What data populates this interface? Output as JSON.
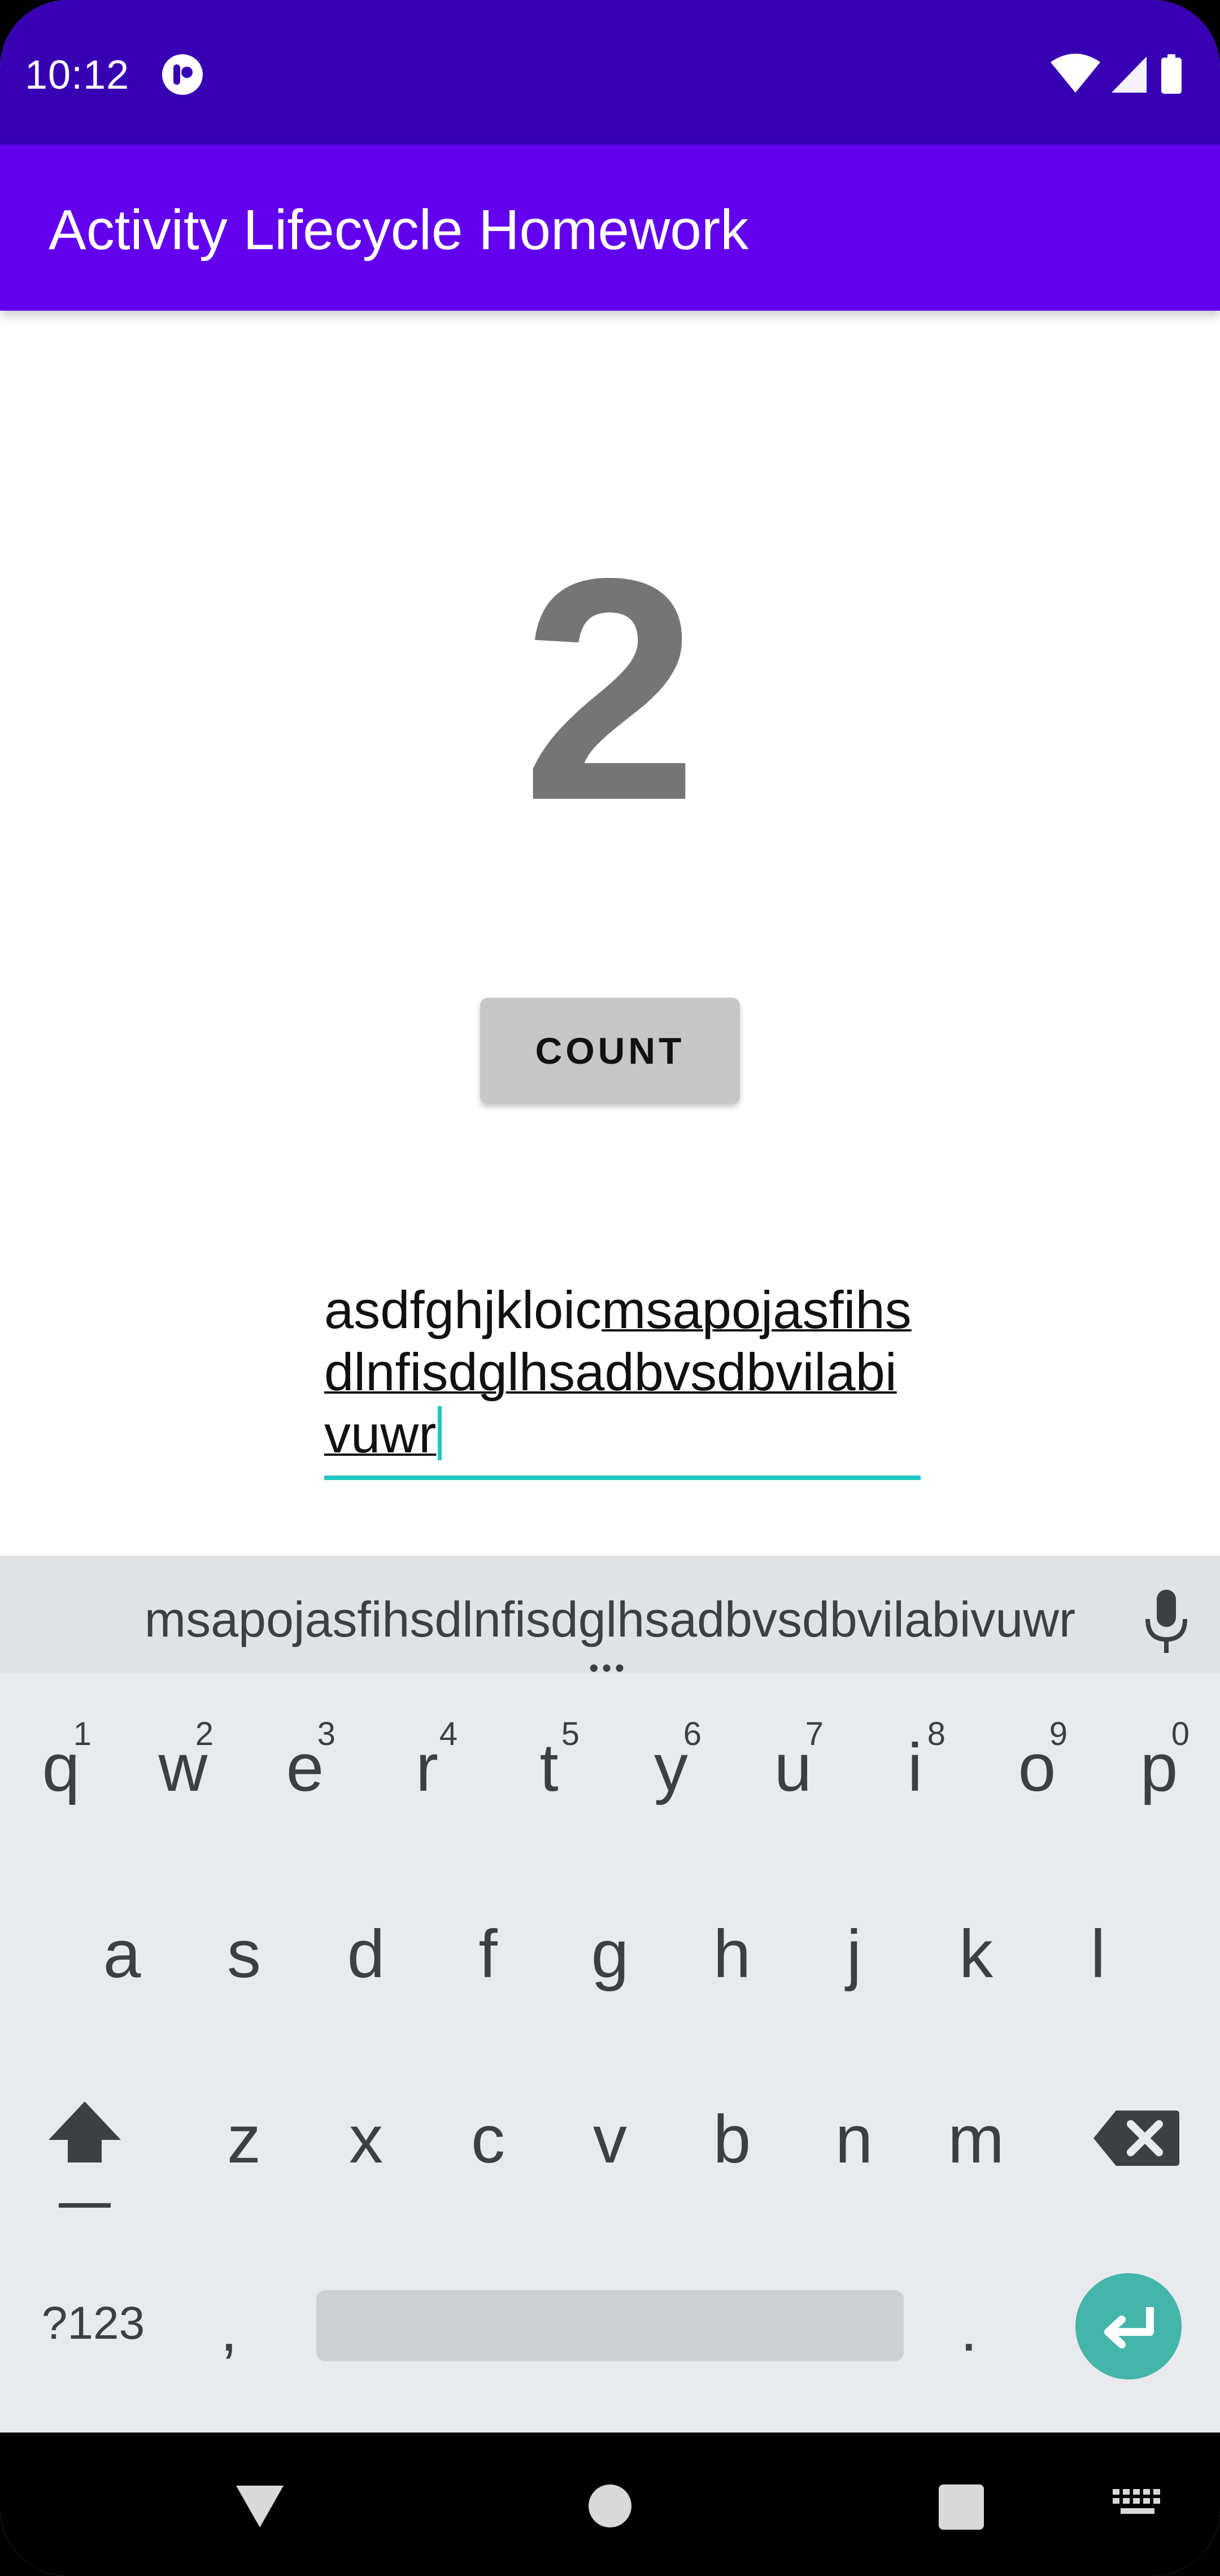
{
  "status_bar": {
    "time": "10:12"
  },
  "app_bar": {
    "title": "Activity Lifecycle Homework"
  },
  "main": {
    "counter": "2",
    "count_button": "COUNT",
    "edit_text": {
      "plain": "asdfghjkloic",
      "composing": "msapojasfihsdlnfisdglhsadbvsdbvilabivuwr"
    }
  },
  "keyboard": {
    "suggestion": "msapojasfihsdlnfisdglhsadbvsdbvilabivuwr",
    "row1": [
      {
        "k": "q",
        "h": "1"
      },
      {
        "k": "w",
        "h": "2"
      },
      {
        "k": "e",
        "h": "3"
      },
      {
        "k": "r",
        "h": "4"
      },
      {
        "k": "t",
        "h": "5"
      },
      {
        "k": "y",
        "h": "6"
      },
      {
        "k": "u",
        "h": "7"
      },
      {
        "k": "i",
        "h": "8"
      },
      {
        "k": "o",
        "h": "9"
      },
      {
        "k": "p",
        "h": "0"
      }
    ],
    "row2": [
      "a",
      "s",
      "d",
      "f",
      "g",
      "h",
      "j",
      "k",
      "l"
    ],
    "row3": [
      "z",
      "x",
      "c",
      "v",
      "b",
      "n",
      "m"
    ],
    "symbols_label": "?123",
    "comma": ",",
    "period": "."
  },
  "colors": {
    "status_bar": "#3700B3",
    "app_bar": "#6200EE",
    "accent": "#1EC7C0",
    "enter_key": "#44B5A9"
  },
  "icons": [
    "app-notification-icon",
    "wifi-icon",
    "signal-icon",
    "battery-icon",
    "mic-icon",
    "shift-icon",
    "backspace-icon",
    "enter-icon",
    "nav-back-icon",
    "nav-home-icon",
    "nav-recents-icon",
    "keyboard-switch-icon"
  ]
}
